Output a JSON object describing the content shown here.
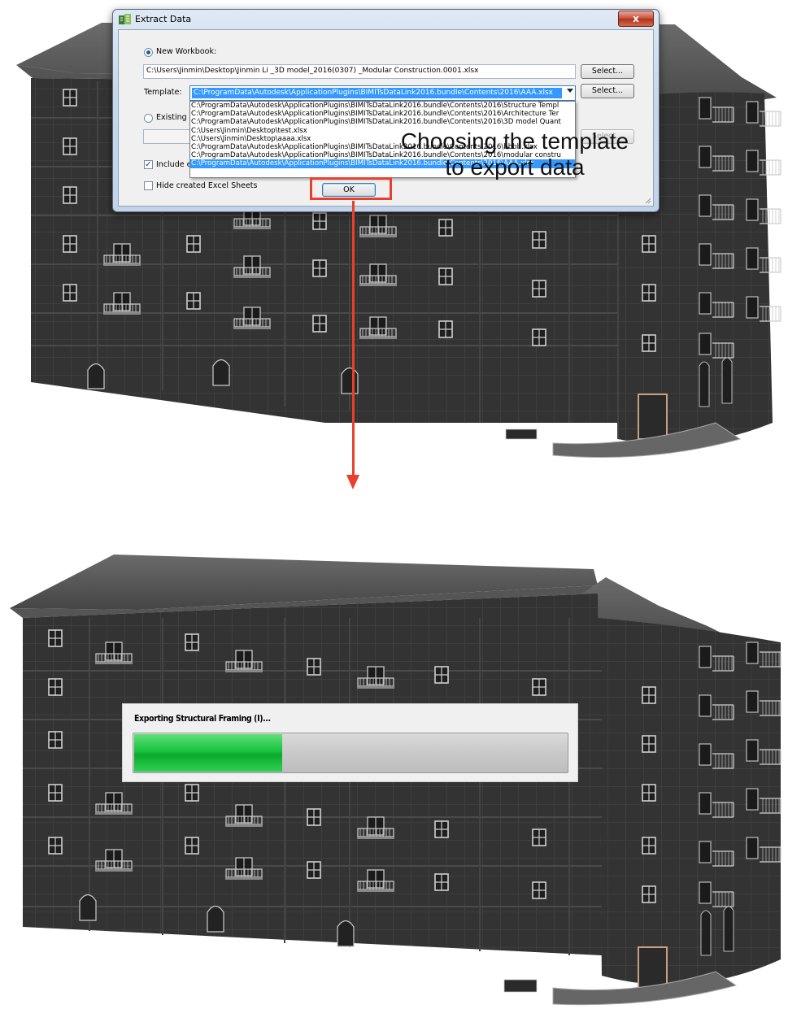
{
  "dialog": {
    "title": "Extract Data",
    "close_label": "x",
    "new_workbook_label": "New Workbook:",
    "new_workbook_path": "C:\\Users\\Jinmin\\Desktop\\Jinmin Li _3D model_2016(0307) _Modular Construction.0001.xlsx",
    "select_label": "Select...",
    "template_label": "Template:",
    "template_selected": "C:\\ProgramData\\Autodesk\\ApplicationPlugins\\BIMITsDataLink2016.bundle\\Contents\\2016\\AAA.xlsx",
    "template_select_label": "Select...",
    "template_options": [
      "C:\\ProgramData\\Autodesk\\ApplicationPlugins\\BIMITsDataLink2016.bundle\\Contents\\2016\\Structure Templ",
      "C:\\ProgramData\\Autodesk\\ApplicationPlugins\\BIMITsDataLink2016.bundle\\Contents\\2016\\Architecture Ter",
      "C:\\ProgramData\\Autodesk\\ApplicationPlugins\\BIMITsDataLink2016.bundle\\Contents\\2016\\3D model Quant",
      "C:\\Users\\Jinmin\\Desktop\\test.xlsx",
      "C:\\Users\\Jinmin\\Desktop\\aaaa.xlsx",
      "C:\\ProgramData\\Autodesk\\ApplicationPlugins\\BIMITsDataLink2016.bundle\\Contents\\2016\\bbbb.xlsx",
      "C:\\ProgramData\\Autodesk\\ApplicationPlugins\\BIMITsDataLink2016.bundle\\Contents\\2016\\modular constru",
      "C:\\ProgramData\\Autodesk\\ApplicationPlugins\\BIMITsDataLink2016.bundle\\Contents\\2016\\AAA.xlsx"
    ],
    "existing_label": "Existing W",
    "existing_select_label": "Select...",
    "include_label": "Include e",
    "hide_label": "Hide created Excel Sheets",
    "ok_label": "OK"
  },
  "annotation": {
    "line1": "Choosing the template",
    "line2": "to export data",
    "color": "#e8402c"
  },
  "progress": {
    "label": "Exporting Structural Framing (I)...",
    "fraction": 0.345,
    "color": "#18c23e"
  },
  "icons": [
    "app-icon",
    "close-icon",
    "dropdown-arrow-icon",
    "resize-grip-icon"
  ]
}
